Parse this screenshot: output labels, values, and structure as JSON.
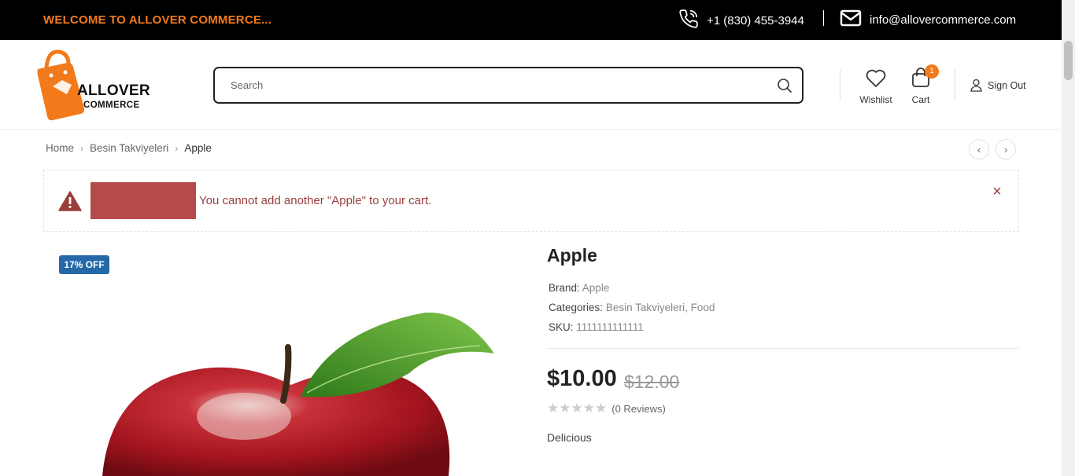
{
  "topbar": {
    "welcome": "WELCOME TO ALLOVER COMMERCE...",
    "phone": "+1 (830) 455-3944",
    "email": "info@allovercommerce.com",
    "phone_icon": "phone-icon",
    "email_icon": "envelope-icon"
  },
  "header": {
    "logo_line1": "ALLOVER",
    "logo_line2": "COMMERCE",
    "search_placeholder": "Search",
    "search_value": "",
    "wishlist_label": "Wishlist",
    "cart_label": "Cart",
    "cart_count": "1",
    "signout_label": "Sign Out"
  },
  "breadcrumb": {
    "items": [
      "Home",
      "Besin Takviyeleri",
      "Apple"
    ]
  },
  "notice": {
    "message": "You cannot add another \"Apple\" to your cart.",
    "icon": "warning-icon",
    "close_label": "×"
  },
  "product": {
    "discount_badge": "17% OFF",
    "title": "Apple",
    "brand_label": "Brand:",
    "brand_value": "Apple",
    "categories_label": "Categories:",
    "categories_value": "Besin Takviyeleri, Food",
    "sku_label": "SKU:",
    "sku_value": "1111111111111",
    "price": "$10.00",
    "old_price": "$12.00",
    "rating": 0,
    "reviews": "(0 Reviews)",
    "description": "Delicious"
  },
  "colors": {
    "accent": "#f27a1a",
    "topbar_bg": "#000000",
    "notice_text": "#9b3d3d",
    "badge_bg": "#2468a8"
  }
}
